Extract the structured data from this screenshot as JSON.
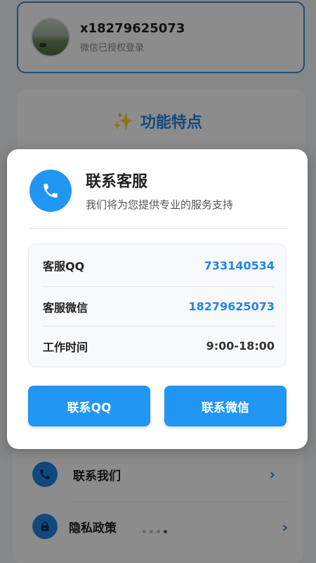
{
  "user": {
    "name": "x18279625073",
    "status": "微信已授权登录"
  },
  "features": {
    "title": "功能特点"
  },
  "menu": {
    "items": [
      {
        "label": "联系我们"
      },
      {
        "label": "隐私政策"
      }
    ]
  },
  "pager": {
    "total": 4,
    "active": 4
  },
  "modal": {
    "title": "联系客服",
    "subtitle": "我们将为您提供专业的服务支持",
    "rows": [
      {
        "label": "客服QQ",
        "value": "733140534"
      },
      {
        "label": "客服微信",
        "value": "18279625073"
      },
      {
        "label": "工作时间",
        "value": "9:00-18:00"
      }
    ],
    "buttons": {
      "qq": "联系QQ",
      "wechat": "联系微信"
    }
  },
  "colors": {
    "accent": "#2196f3",
    "link": "#1f86e6",
    "overlay": "rgba(0,0,0,0.45)"
  },
  "icons": [
    "phone-icon",
    "lock-icon",
    "chevron-right-icon",
    "sparkle-icon"
  ]
}
